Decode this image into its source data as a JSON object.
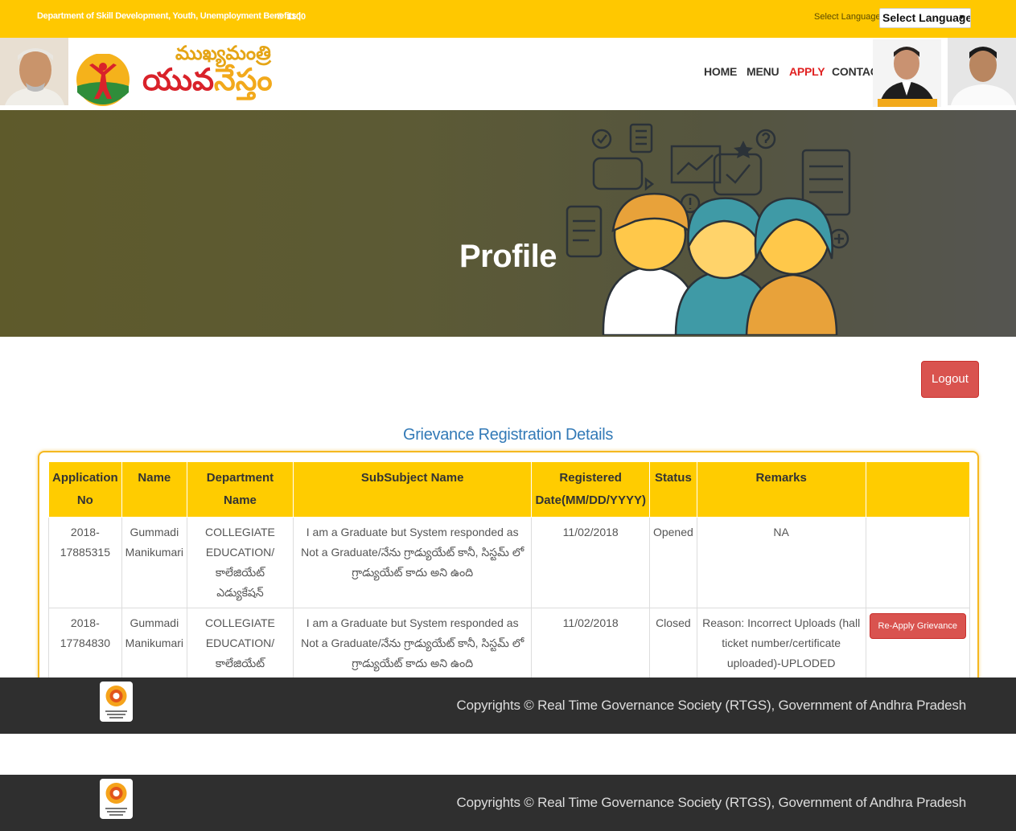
{
  "topbar": {
    "department": "Department of Skill Development, Youth, Unemployment Benefits |",
    "phone": "1100",
    "select_language_label": "Select Language",
    "select_language_value": "Select Language"
  },
  "header": {
    "logo_top_text": "ముఖ్యమంత్రి",
    "logo_main_red": "యువ",
    "logo_main_yellow": "నేస్తం",
    "nav": [
      {
        "label": "HOME"
      },
      {
        "label": "MENU"
      },
      {
        "label": "APPLY"
      },
      {
        "label": "CONTACT"
      }
    ]
  },
  "banner": {
    "title": "Profile"
  },
  "actions": {
    "logout_label": "Logout"
  },
  "grievance": {
    "title": "Grievance Registration Details",
    "columns": [
      "Application No",
      "Name",
      "Department Name",
      "SubSubject Name",
      "Registered Date(MM/DD/YYYY)",
      "Status",
      "Remarks",
      ""
    ],
    "rows": [
      {
        "application_no": "2018-17885315",
        "name": "Gummadi Manikumari",
        "department": "COLLEGIATE EDUCATION/ కాలేజియేట్ ఎడ్యుకేషన్",
        "subsubject": "I am a Graduate but System responded as Not a Graduate/నేను గ్రాడ్యుయేట్ కానీ, సిస్టమ్ లో గ్రాడ్యుయేట్ కాదు అని ఉంది",
        "registered_date": "11/02/2018",
        "status": "Opened",
        "remarks": "NA",
        "action": ""
      },
      {
        "application_no": "2018-17784830",
        "name": "Gummadi Manikumari",
        "department": "COLLEGIATE EDUCATION/ కాలేజియేట్ ఎడ్యుకేషన్",
        "subsubject": "I am a Graduate but System responded as Not a Graduate/నేను గ్రాడ్యుయేట్ కానీ, సిస్టమ్ లో గ్రాడ్యుయేట్ కాదు అని ఉంది",
        "registered_date": "11/02/2018",
        "status": "Closed",
        "remarks": "Reason: Incorrect Uploads (hall ticket number/certificate uploaded)-UPLODED CERTIFICATES NO CLARITY",
        "action": "Re-Apply Grievance"
      }
    ]
  },
  "footer": {
    "copyright": "Copyrights © Real Time Governance Society (RTGS), Government of Andhra Pradesh"
  },
  "colors": {
    "topbar": "#ffc800",
    "table_header": "#ffcc00",
    "danger_button": "#d9534f",
    "title_blue": "#337ab7",
    "footer": "#2f2f2f",
    "nav_active": "#e02020"
  }
}
